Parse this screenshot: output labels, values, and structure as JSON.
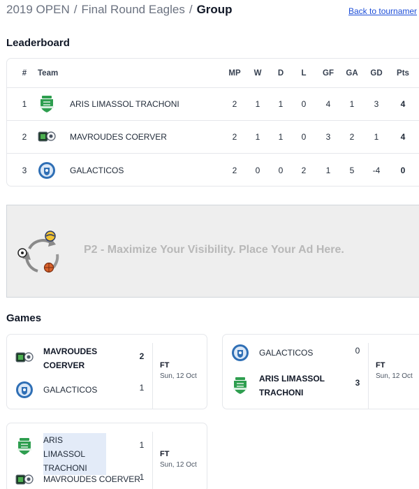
{
  "breadcrumb": {
    "items": [
      "2019 OPEN",
      "Final Round Eagles"
    ],
    "current": "Group",
    "separator": "/"
  },
  "back_link": "Back to tournamer",
  "leaderboard": {
    "title": "Leaderboard",
    "columns": {
      "rank": "#",
      "team": "Team",
      "mp": "MP",
      "w": "W",
      "d": "D",
      "l": "L",
      "gf": "GF",
      "ga": "GA",
      "gd": "GD",
      "pts": "Pts"
    },
    "rows": [
      {
        "rank": "1",
        "team": "ARIS LIMASSOL TRACHONI",
        "logo": "aris-shield-logo",
        "mp": "2",
        "w": "1",
        "d": "1",
        "l": "0",
        "gf": "4",
        "ga": "1",
        "gd": "3",
        "pts": "4"
      },
      {
        "rank": "2",
        "team": "MAVROUDES COERVER",
        "logo": "mavroudes-logo",
        "mp": "2",
        "w": "1",
        "d": "1",
        "l": "0",
        "gf": "3",
        "ga": "2",
        "gd": "1",
        "pts": "4"
      },
      {
        "rank": "3",
        "team": "GALACTICOS",
        "logo": "galacticos-logo",
        "mp": "2",
        "w": "0",
        "d": "0",
        "l": "2",
        "gf": "1",
        "ga": "5",
        "gd": "-4",
        "pts": "0"
      }
    ]
  },
  "ad": {
    "text": "P2 - Maximize Your Visibility. Place Your Ad Here.",
    "icon": "sports-balls-cycle-icon"
  },
  "games": {
    "title": "Games",
    "items": [
      {
        "home": {
          "name": "MAVROUDES COERVER",
          "score": "2",
          "logo": "mavroudes-logo",
          "winner": true
        },
        "away": {
          "name": "GALACTICOS",
          "score": "1",
          "logo": "galacticos-logo",
          "winner": false
        },
        "status": "FT",
        "date": "Sun, 12 Oct"
      },
      {
        "home": {
          "name": "GALACTICOS",
          "score": "0",
          "logo": "galacticos-logo",
          "winner": false
        },
        "away": {
          "name": "ARIS LIMASSOL TRACHONI",
          "score": "3",
          "logo": "aris-shield-logo",
          "winner": true
        },
        "status": "FT",
        "date": "Sun, 12 Oct"
      },
      {
        "home": {
          "name": "ARIS LIMASSOL TRACHONI",
          "score": "1",
          "logo": "aris-shield-logo",
          "winner": false
        },
        "away": {
          "name": "MAVROUDES COERVER",
          "score": "1",
          "logo": "mavroudes-logo",
          "winner": false
        },
        "status": "FT",
        "date": "Sun, 12 Oct"
      }
    ]
  },
  "colors": {
    "link": "#1d4ed8",
    "aris_green": "#2e9e4f",
    "galacticos_blue": "#2f6fb5",
    "ad_background": "#eeeeee",
    "ad_text": "#b8b8b8"
  }
}
